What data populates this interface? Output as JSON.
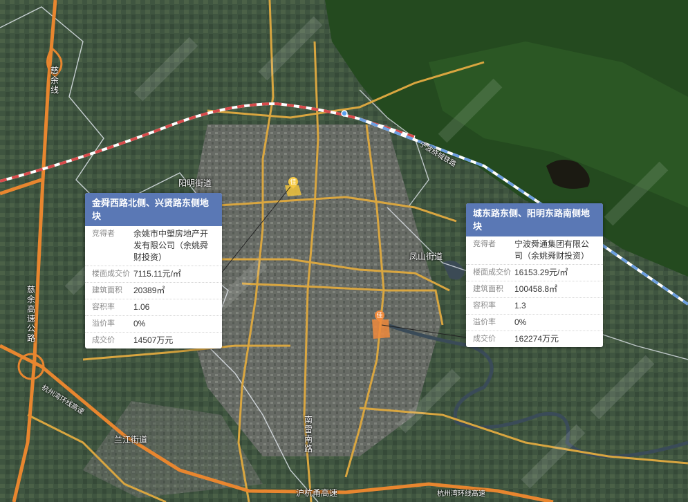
{
  "map": {
    "place_labels": {
      "yangming": "阳明街道",
      "fengshan": "凤山街道",
      "lanjiang": "兰江街道",
      "expressway_bottom": "沪杭甬高速",
      "expressway_sw": "杭州湾环线高速",
      "expressway_se": "杭州湾环线高速",
      "railway_ne": "宁波绕城铁路"
    },
    "vertical_labels": {
      "cixi_left_top": "慈余线",
      "cixi_left_bottom": "慈余高速公路",
      "nanlei_road": "南雷南路"
    },
    "pins": [
      "佳",
      "佳"
    ],
    "colors": {
      "road_orange": "#e8862f",
      "road_yellow": "#d9a640",
      "railway_red": "#d84b4b",
      "railway_blue": "#6d9fe0",
      "card_header": "#5a78b5"
    }
  },
  "cards": [
    {
      "title": "金舜西路北侧、兴贤路东侧地块",
      "rows": [
        {
          "k": "竞得者",
          "v": "余姚市中塑房地产开发有限公司（余姚舜财投资）"
        },
        {
          "k": "楼面成交价",
          "v": "7115.11元/㎡"
        },
        {
          "k": "建筑面积",
          "v": "20389㎡"
        },
        {
          "k": "容积率",
          "v": "1.06"
        },
        {
          "k": "溢价率",
          "v": "0%"
        },
        {
          "k": "成交价",
          "v": "14507万元"
        }
      ]
    },
    {
      "title": "城东路东侧、阳明东路南侧地块",
      "rows": [
        {
          "k": "竞得者",
          "v": "宁波舜通集团有限公司（余姚舜财投资）"
        },
        {
          "k": "楼面成交价",
          "v": "16153.29元/㎡"
        },
        {
          "k": "建筑面积",
          "v": "100458.8㎡"
        },
        {
          "k": "容积率",
          "v": "1.3"
        },
        {
          "k": "溢价率",
          "v": "0%"
        },
        {
          "k": "成交价",
          "v": "162274万元"
        }
      ]
    }
  ]
}
